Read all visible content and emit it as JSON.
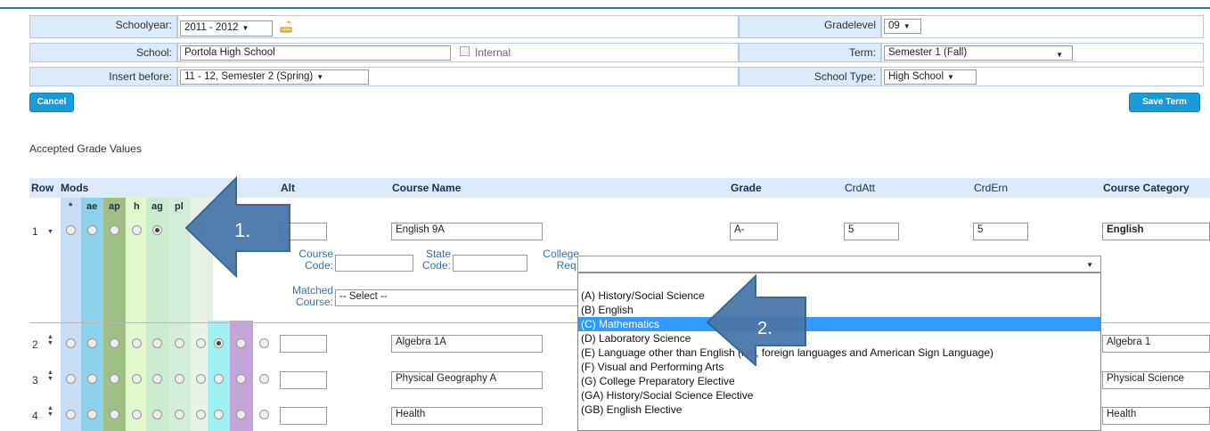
{
  "form": {
    "schoolyear_label": "Schoolyear:",
    "schoolyear_value": "2011 - 2012",
    "school_label": "School:",
    "school_value": "Portola High School",
    "internal_label": "Internal",
    "insert_before_label": "Insert before:",
    "insert_before_value": "11 - 12, Semester 2 (Spring)",
    "gradelevel_label": "Gradelevel",
    "gradelevel_value": "09",
    "term_label": "Term:",
    "term_value": "Semester 1 (Fall)",
    "school_type_label": "School Type:",
    "school_type_value": "High School"
  },
  "buttons": {
    "cancel": "Cancel",
    "save_term": "Save Term"
  },
  "section_title": "Accepted Grade Values",
  "table": {
    "headers": {
      "row": "Row",
      "mods": "Mods",
      "alt": "Alt",
      "course_name": "Course Name",
      "grade": "Grade",
      "crd_att": "CrdAtt",
      "crd_ern": "CrdErn",
      "course_category": "Course Category"
    },
    "mod_headers": [
      "*",
      "ae",
      "ap",
      "h",
      "ag",
      "pl"
    ],
    "rows": [
      {
        "num": "1",
        "course_name": "English 9A",
        "grade": "A-",
        "crd_att": "5",
        "crd_ern": "5",
        "category": "English"
      },
      {
        "num": "2",
        "course_name": "Algebra 1A",
        "category": "Algebra 1"
      },
      {
        "num": "3",
        "course_name": "Physical Geography A",
        "category": "Physical Science"
      },
      {
        "num": "4",
        "course_name": "Health",
        "category": "Health"
      }
    ],
    "detail": {
      "course_code_label_1": "Course",
      "course_code_label_2": "Code:",
      "state_code_label_1": "State",
      "state_code_label_2": "Code:",
      "college_req_label_1": "College",
      "college_req_label_2": "Req:",
      "matched_label_1": "Matched",
      "matched_label_2": "Course:",
      "matched_value": "-- Select --"
    }
  },
  "college_req_options": [
    "(A) History/Social Science",
    "(B) English",
    "(C) Mathematics",
    "(D) Laboratory Science",
    "(E) Language other than English (i.e., foreign languages and American Sign Language)",
    "(F) Visual and Performing Arts",
    "(G) College Preparatory Elective",
    "(GA) History/Social Science Elective",
    "(GB) English Elective"
  ],
  "college_req_selected": "(C) Mathematics",
  "callouts": {
    "first": "1.",
    "second": "2."
  },
  "colors": {
    "accent": "#1a9ad8",
    "header_bg": "#dbe9f9",
    "highlight": "#3399ff",
    "callout": "#4a77a8"
  }
}
